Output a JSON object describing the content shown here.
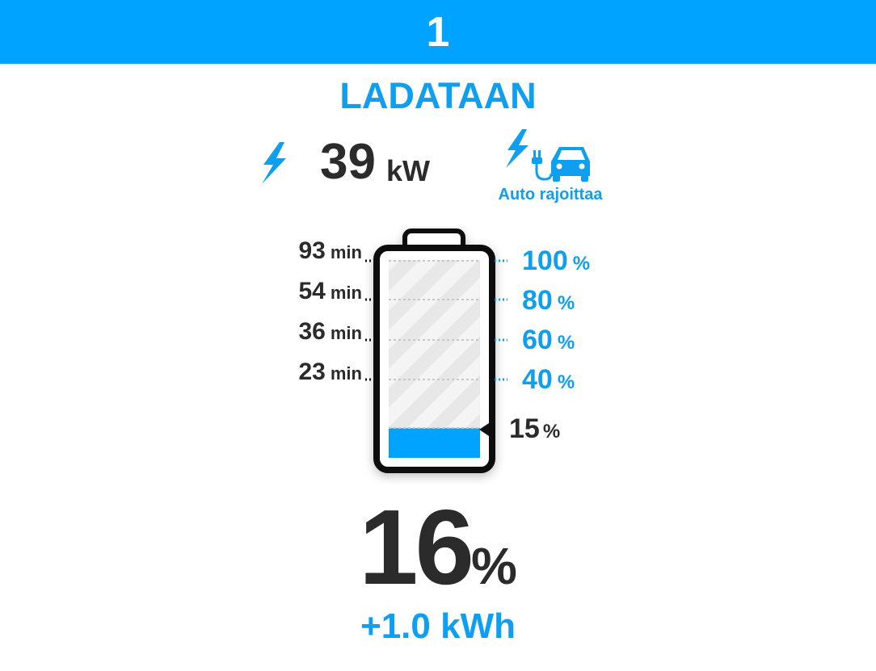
{
  "header": {
    "connector_number": "1"
  },
  "status": {
    "label": "LADATAAN"
  },
  "power": {
    "value": "39",
    "unit": "kW",
    "icon": "lightning-icon"
  },
  "limit": {
    "label": "Auto rajoittaa",
    "icon": "car-charging-icon"
  },
  "battery": {
    "charge_fraction": 0.15,
    "target_fraction": 1.0,
    "fill_color": "#00a3ff",
    "outline_color": "#111111"
  },
  "time_marks": [
    {
      "value": "93",
      "unit": "min"
    },
    {
      "value": "54",
      "unit": "min"
    },
    {
      "value": "36",
      "unit": "min"
    },
    {
      "value": "23",
      "unit": "min"
    }
  ],
  "percent_marks": [
    {
      "value": "100",
      "unit": "%"
    },
    {
      "value": "80",
      "unit": "%"
    },
    {
      "value": "60",
      "unit": "%"
    },
    {
      "value": "40",
      "unit": "%"
    }
  ],
  "current_marker": {
    "value": "15",
    "unit": "%"
  },
  "state_of_charge": {
    "value": "16",
    "unit": "%"
  },
  "energy_added": {
    "label": "+1.0 kWh"
  },
  "colors": {
    "accent": "#00a3ff",
    "text_blue": "#0e9ff0",
    "text_dark": "#2b2b2b"
  }
}
